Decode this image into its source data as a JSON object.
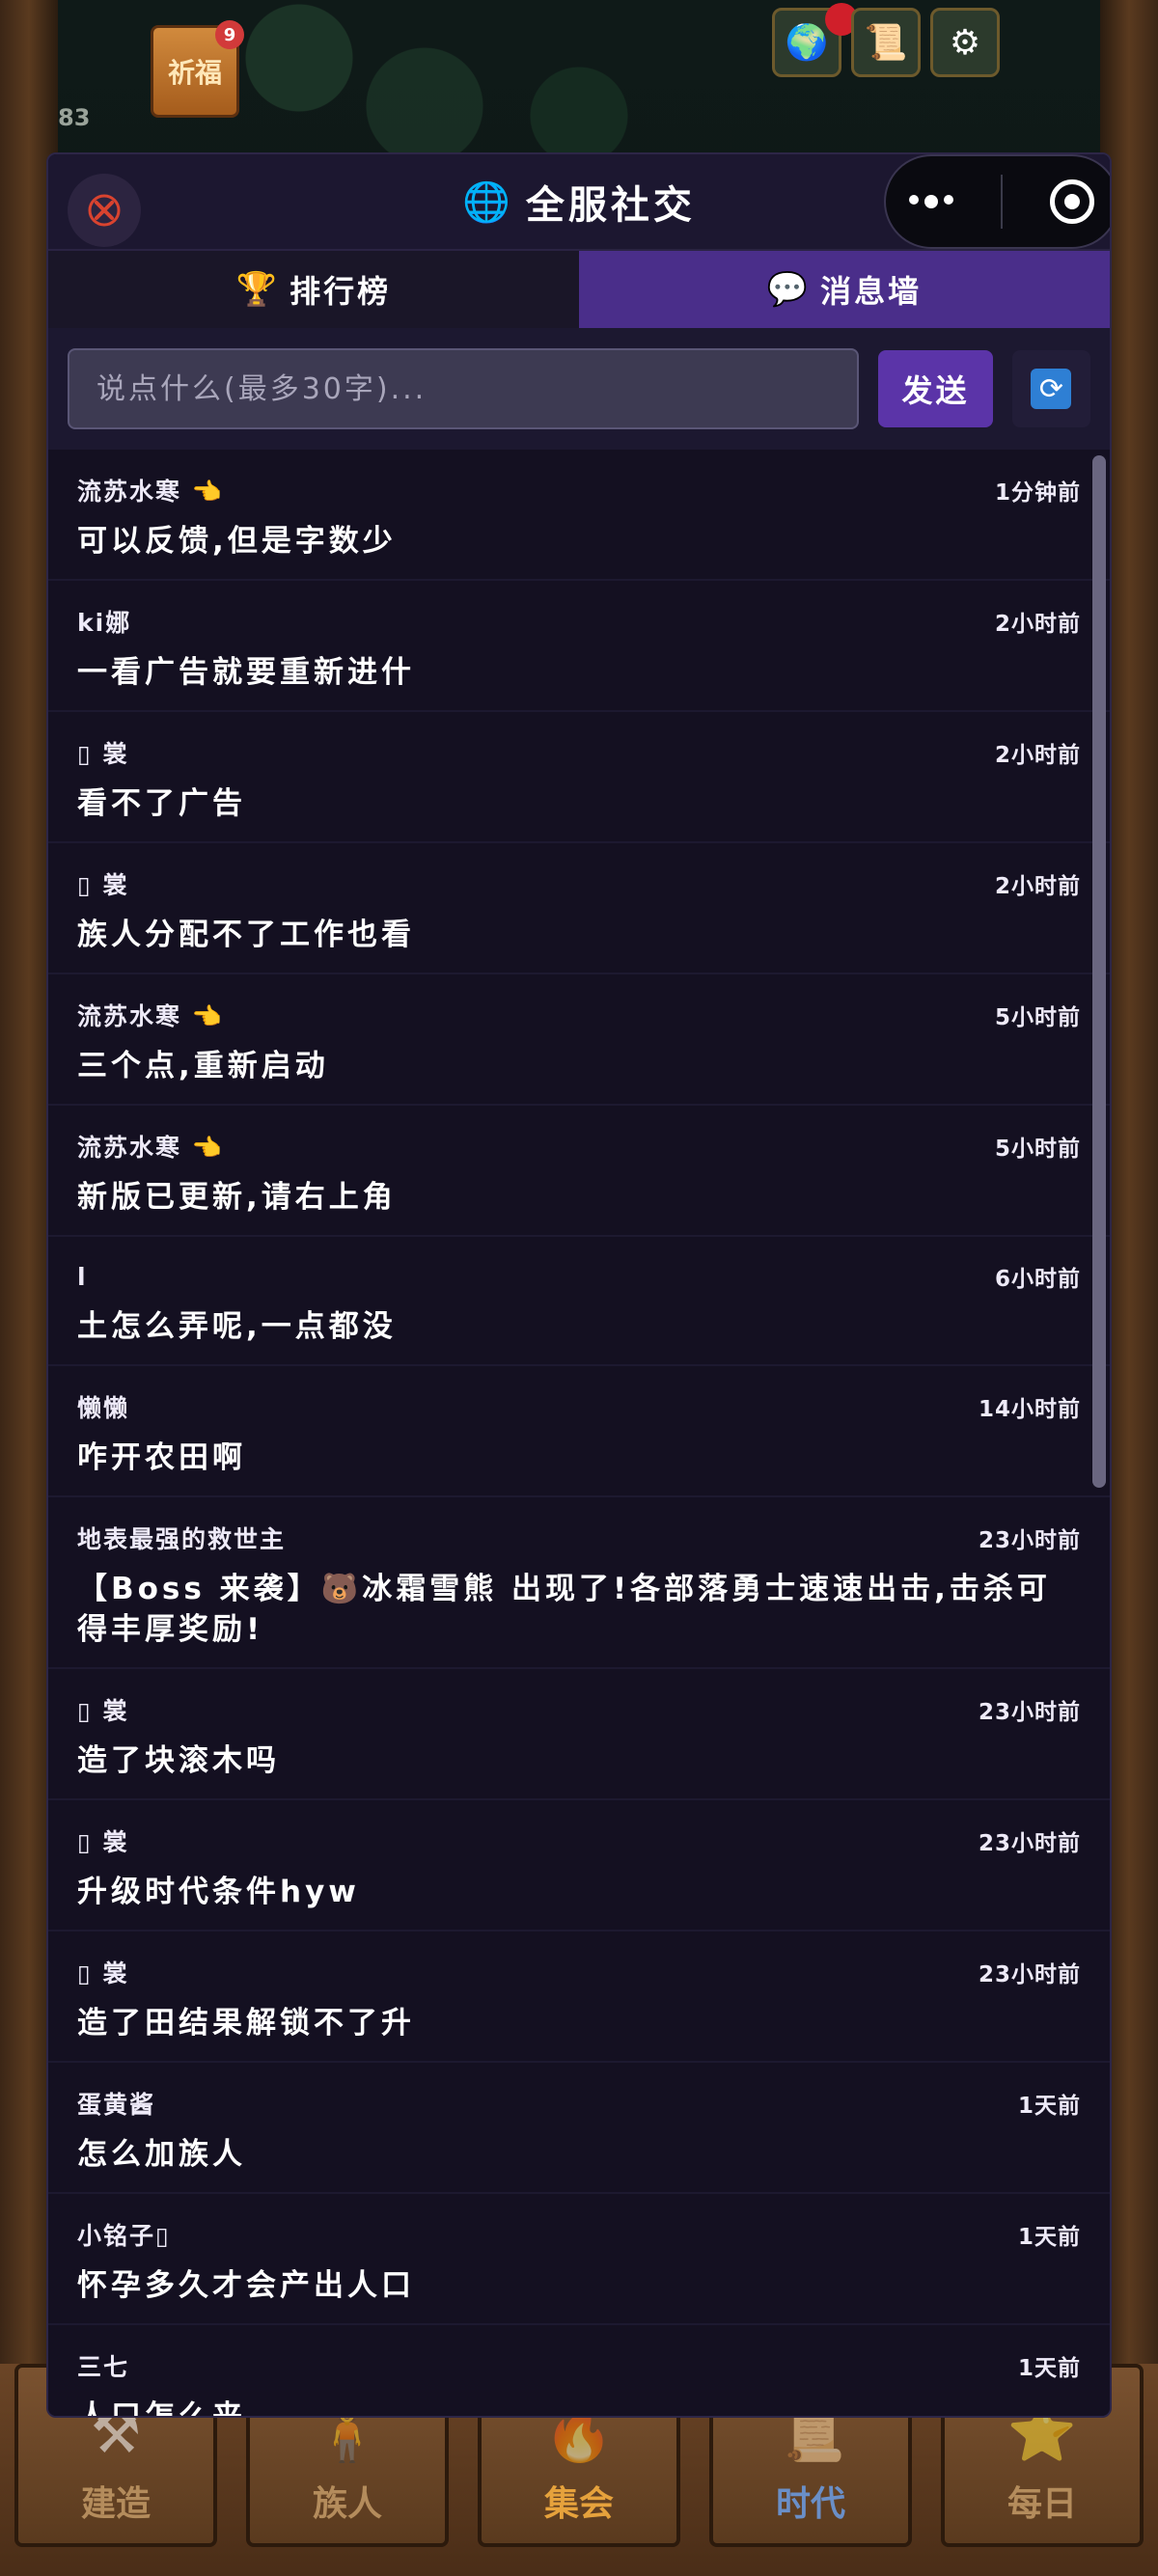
{
  "game": {
    "counter": "83",
    "pray_label": "祈福",
    "pray_badge": "9",
    "bottom_nav": [
      {
        "label": "建造",
        "icon": "⚒"
      },
      {
        "label": "族人",
        "icon": "🧍"
      },
      {
        "label": "集会",
        "icon": "🔥"
      },
      {
        "label": "时代",
        "icon": "📜"
      },
      {
        "label": "每日",
        "icon": "⭐"
      }
    ]
  },
  "panel": {
    "title": "全服社交",
    "tabs": [
      {
        "label": "排行榜",
        "icon": "🏆"
      },
      {
        "label": "消息墙",
        "icon": "💬"
      }
    ],
    "composer": {
      "placeholder": "说点什么(最多30字)...",
      "send_label": "发送"
    },
    "messages": [
      {
        "user": "流苏水寒 👈",
        "time": "1分钟前",
        "text": "可以反馈,但是字数少"
      },
      {
        "user": "ki娜",
        "time": "2小时前",
        "text": "一看广告就要重新进什"
      },
      {
        "user": "▯ 裳",
        "time": "2小时前",
        "text": "看不了广告"
      },
      {
        "user": "▯ 裳",
        "time": "2小时前",
        "text": "族人分配不了工作也看"
      },
      {
        "user": "流苏水寒 👈",
        "time": "5小时前",
        "text": "三个点,重新启动"
      },
      {
        "user": "流苏水寒 👈",
        "time": "5小时前",
        "text": "新版已更新,请右上角"
      },
      {
        "user": "l",
        "time": "6小时前",
        "text": "土怎么弄呢,一点都没"
      },
      {
        "user": "懒懒",
        "time": "14小时前",
        "text": "咋开农田啊"
      },
      {
        "user": "地表最强的救世主",
        "time": "23小时前",
        "text": "【Boss 来袭】🐻冰霜雪熊 出现了!各部落勇士速速出击,击杀可得丰厚奖励!"
      },
      {
        "user": "▯ 裳",
        "time": "23小时前",
        "text": "造了块滚木吗"
      },
      {
        "user": "▯ 裳",
        "time": "23小时前",
        "text": "升级时代条件hyw"
      },
      {
        "user": "▯ 裳",
        "time": "23小时前",
        "text": "造了田结果解锁不了升"
      },
      {
        "user": "蛋黄酱",
        "time": "1天前",
        "text": "怎么加族人"
      },
      {
        "user": "小铭子▯",
        "time": "1天前",
        "text": "怀孕多久才会产出人口"
      },
      {
        "user": "三七",
        "time": "1天前",
        "text": "人口怎么来"
      }
    ]
  }
}
